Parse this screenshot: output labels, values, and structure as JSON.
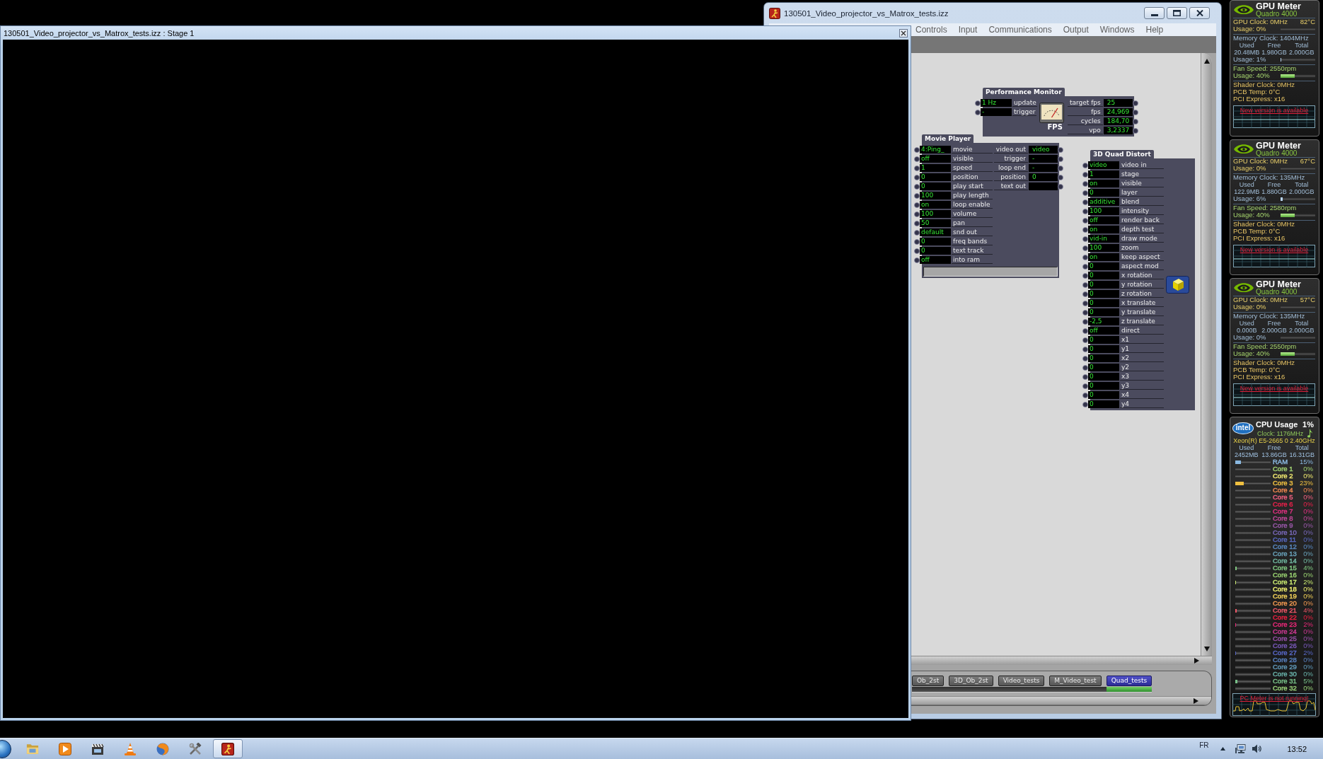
{
  "stage_window": {
    "title": "130501_Video_projector_vs_Matrox_tests.izz : Stage 1"
  },
  "editor_window": {
    "title": "130501_Video_projector_vs_Matrox_tests.izz",
    "menu": [
      "Controls",
      "Input",
      "Communications",
      "Output",
      "Windows",
      "Help"
    ],
    "actors": [
      {
        "kind": "monitor",
        "title": "Performance Monitor",
        "icon_caption": "FPS",
        "inputs": [
          {
            "value": "1 Hz",
            "label": "update"
          },
          {
            "value": "-",
            "label": "trigger"
          }
        ],
        "outputs": [
          {
            "label": "target fps",
            "value": "25"
          },
          {
            "label": "fps",
            "value": "24,969"
          },
          {
            "label": "cycles",
            "value": "184,70"
          },
          {
            "label": "vpo",
            "value": "3,2337"
          }
        ]
      },
      {
        "kind": "player",
        "title": "Movie Player",
        "inputs": [
          {
            "value": "4:Ping_",
            "label": "movie"
          },
          {
            "value": "off",
            "label": "visible"
          },
          {
            "value": "1",
            "label": "speed"
          },
          {
            "value": "0",
            "label": "position"
          },
          {
            "value": "0",
            "label": "play start"
          },
          {
            "value": "100",
            "label": "play length"
          },
          {
            "value": "on",
            "label": "loop enable"
          },
          {
            "value": "100",
            "label": "volume"
          },
          {
            "value": "50",
            "label": "pan"
          },
          {
            "value": "default",
            "label": "snd out"
          },
          {
            "value": "0",
            "label": "freq bands"
          },
          {
            "value": "0",
            "label": "text track"
          },
          {
            "value": "off",
            "label": "into ram"
          }
        ],
        "outputs": [
          {
            "label": "video out",
            "value": "video"
          },
          {
            "label": "trigger",
            "value": "-"
          },
          {
            "label": "loop end",
            "value": "-"
          },
          {
            "label": "position",
            "value": "0"
          },
          {
            "label": "text out"
          }
        ],
        "progress": {
          "level": 0
        }
      },
      {
        "kind": "quad",
        "title": "3D Quad Distort",
        "inputs": [
          {
            "value": "video",
            "label": "video in"
          },
          {
            "value": "1",
            "label": "stage"
          },
          {
            "value": "on",
            "label": "visible"
          },
          {
            "value": "0",
            "label": "layer"
          },
          {
            "value": "additive",
            "label": "blend"
          },
          {
            "value": "100",
            "label": "intensity"
          },
          {
            "value": "off",
            "label": "render back"
          },
          {
            "value": "on",
            "label": "depth test"
          },
          {
            "value": "vid-in",
            "label": "draw mode"
          },
          {
            "value": "100",
            "label": "zoom"
          },
          {
            "value": "on",
            "label": "keep aspect"
          },
          {
            "value": "0",
            "label": "aspect mod"
          },
          {
            "value": "0",
            "label": "x rotation"
          },
          {
            "value": "0",
            "label": "y rotation"
          },
          {
            "value": "0",
            "label": "z rotation"
          },
          {
            "value": "0",
            "label": "x translate"
          },
          {
            "value": "0",
            "label": "y translate"
          },
          {
            "value": "-2,5",
            "label": "z translate"
          },
          {
            "value": "off",
            "label": "direct"
          },
          {
            "value": "0",
            "label": "x1"
          },
          {
            "value": "0",
            "label": "y1"
          },
          {
            "value": "0",
            "label": "x2"
          },
          {
            "value": "0",
            "label": "y2"
          },
          {
            "value": "0",
            "label": "x3"
          },
          {
            "value": "0",
            "label": "y3"
          },
          {
            "value": "0",
            "label": "x4"
          },
          {
            "value": "0",
            "label": "y4"
          }
        ]
      }
    ],
    "scene_tabs": [
      {
        "label": "Ob_2st",
        "selected": false
      },
      {
        "label": "3D_Ob_2st",
        "selected": false
      },
      {
        "label": "Video_tests",
        "selected": false
      },
      {
        "label": "M_Video_test",
        "selected": false
      },
      {
        "label": "Quad_tests",
        "selected": true
      }
    ]
  },
  "gpu_meters": [
    {
      "title": "GPU Meter",
      "model": "Quadro 4000",
      "gpu_clock": "GPU Clock: 0MHz",
      "temperature": "82°C",
      "gpu_usage": {
        "text": "Usage: 0%",
        "level": 0
      },
      "memory_clock": "Memory Clock: 1404MHz",
      "memory_headers": [
        "Used",
        "Free",
        "Total"
      ],
      "memory_values": [
        "20.48MB",
        "1.980GB",
        "2.000GB"
      ],
      "memory_usage": {
        "text": "Usage: 1%",
        "level": 0.01
      },
      "fan_speed": "Fan Speed: 2550rpm",
      "fan_usage": {
        "text": "Usage: 40%",
        "level": 0.4
      },
      "shader_clock": "Shader Clock: 0MHz",
      "pcb_temp": "PCB Temp: 0°C",
      "pci_express": "PCI Express: x16",
      "notice": "New version is available"
    },
    {
      "title": "GPU Meter",
      "model": "Quadro 4000",
      "gpu_clock": "GPU Clock: 0MHz",
      "temperature": "67°C",
      "gpu_usage": {
        "text": "Usage: 0%",
        "level": 0
      },
      "memory_clock": "Memory Clock: 135MHz",
      "memory_headers": [
        "Used",
        "Free",
        "Total"
      ],
      "memory_values": [
        "122.9MB",
        "1.880GB",
        "2.000GB"
      ],
      "memory_usage": {
        "text": "Usage: 6%",
        "level": 0.06
      },
      "fan_speed": "Fan Speed: 2580rpm",
      "fan_usage": {
        "text": "Usage: 40%",
        "level": 0.4
      },
      "shader_clock": "Shader Clock: 0MHz",
      "pcb_temp": "PCB Temp: 0°C",
      "pci_express": "PCI Express: x16",
      "notice": "New version is available"
    },
    {
      "title": "GPU Meter",
      "model": "Quadro 4000",
      "gpu_clock": "GPU Clock: 0MHz",
      "temperature": "57°C",
      "gpu_usage": {
        "text": "Usage: 0%",
        "level": 0
      },
      "memory_clock": "Memory Clock: 135MHz",
      "memory_headers": [
        "Used",
        "Free",
        "Total"
      ],
      "memory_values": [
        "0.000B",
        "2.000GB",
        "2.000GB"
      ],
      "memory_usage": {
        "text": "Usage: 0%",
        "level": 0
      },
      "fan_speed": "Fan Speed: 2550rpm",
      "fan_usage": {
        "text": "Usage: 40%",
        "level": 0.4
      },
      "shader_clock": "Shader Clock: 0MHz",
      "pcb_temp": "PCB Temp: 0°C",
      "pci_express": "PCI Express: x16",
      "notice": "New version is available"
    }
  ],
  "cpu_meter": {
    "logo": "intel",
    "title": "CPU Usage",
    "total": "1%",
    "clock": "Clock: 1176MHz",
    "processor": "Xeon(R) E5-2665 0 2.40GHz",
    "memory_headers": [
      "Used",
      "Free",
      "Total"
    ],
    "memory_values": [
      "2452MB",
      "13.86GB",
      "16.31GB"
    ],
    "rows": [
      {
        "label": "RAM",
        "value": "15%",
        "level": 0.15,
        "color": "#8ab8e0"
      },
      {
        "label": "Core 1",
        "value": "0%",
        "level": 0,
        "color": "#a0d070"
      },
      {
        "label": "Core 2",
        "value": "0%",
        "level": 0,
        "color": "#f0e870"
      },
      {
        "label": "Core 3",
        "value": "23%",
        "level": 0.23,
        "color": "#f0c040"
      },
      {
        "label": "Core 4",
        "value": "0%",
        "level": 0,
        "color": "#f08850"
      },
      {
        "label": "Core 5",
        "value": "0%",
        "level": 0,
        "color": "#f06080"
      },
      {
        "label": "Core 6",
        "value": "0%",
        "level": 0,
        "color": "#e8204a"
      },
      {
        "label": "Core 7",
        "value": "0%",
        "level": 0,
        "color": "#e03080"
      },
      {
        "label": "Core 8",
        "value": "0%",
        "level": 0,
        "color": "#c04898"
      },
      {
        "label": "Core 9",
        "value": "0%",
        "level": 0,
        "color": "#9858a8"
      },
      {
        "label": "Core 10",
        "value": "0%",
        "level": 0,
        "color": "#7868b8"
      },
      {
        "label": "Core 11",
        "value": "0%",
        "level": 0,
        "color": "#5868c0"
      },
      {
        "label": "Core 12",
        "value": "0%",
        "level": 0,
        "color": "#5888c0"
      },
      {
        "label": "Core 13",
        "value": "0%",
        "level": 0,
        "color": "#68a0b8"
      },
      {
        "label": "Core 14",
        "value": "0%",
        "level": 0,
        "color": "#70b8a0"
      },
      {
        "label": "Core 15",
        "value": "4%",
        "level": 0.04,
        "color": "#80c880"
      },
      {
        "label": "Core 16",
        "value": "0%",
        "level": 0,
        "color": "#98d070"
      },
      {
        "label": "Core 17",
        "value": "2%",
        "level": 0.02,
        "color": "#c8e870"
      },
      {
        "label": "Core 18",
        "value": "0%",
        "level": 0,
        "color": "#f0f070"
      },
      {
        "label": "Core 19",
        "value": "0%",
        "level": 0,
        "color": "#f0d058"
      },
      {
        "label": "Core 20",
        "value": "0%",
        "level": 0,
        "color": "#f09850"
      },
      {
        "label": "Core 21",
        "value": "4%",
        "level": 0.04,
        "color": "#f05868"
      },
      {
        "label": "Core 22",
        "value": "0%",
        "level": 0,
        "color": "#e82040"
      },
      {
        "label": "Core 23",
        "value": "2%",
        "level": 0.02,
        "color": "#e82878"
      },
      {
        "label": "Core 24",
        "value": "0%",
        "level": 0,
        "color": "#c83890"
      },
      {
        "label": "Core 25",
        "value": "0%",
        "level": 0,
        "color": "#9850a8"
      },
      {
        "label": "Core 26",
        "value": "0%",
        "level": 0,
        "color": "#7858b8"
      },
      {
        "label": "Core 27",
        "value": "2%",
        "level": 0.02,
        "color": "#5868c8"
      },
      {
        "label": "Core 28",
        "value": "0%",
        "level": 0,
        "color": "#5880c0"
      },
      {
        "label": "Core 29",
        "value": "0%",
        "level": 0,
        "color": "#6098b8"
      },
      {
        "label": "Core 30",
        "value": "0%",
        "level": 0,
        "color": "#68b0a8"
      },
      {
        "label": "Core 31",
        "value": "5%",
        "level": 0.05,
        "color": "#78c088"
      },
      {
        "label": "Core 32",
        "value": "0%",
        "level": 0,
        "color": "#98d078"
      }
    ],
    "notice": "PC Meter is not running!"
  },
  "taskbar": {
    "apps": [
      {
        "kind": "folder",
        "running": false
      },
      {
        "kind": "play",
        "running": false
      },
      {
        "kind": "film",
        "running": false
      },
      {
        "kind": "cone",
        "running": false
      },
      {
        "kind": "globe",
        "running": false
      },
      {
        "kind": "tools",
        "running": false
      },
      {
        "kind": "figure",
        "running": true
      }
    ],
    "language": "FR",
    "time": "13:52"
  }
}
